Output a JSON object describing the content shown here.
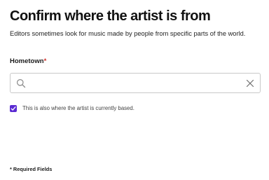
{
  "title": "Confirm where the artist is from",
  "subtitle": "Editors sometimes look for music made by people from specific parts of the world.",
  "hometown_field": {
    "label": "Hometown",
    "required_marker": "*",
    "value": "",
    "placeholder": "",
    "search_icon": "search-icon",
    "clear_icon": "close-icon"
  },
  "based_checkbox": {
    "checked": true,
    "label": "This is also where the artist is currently based.",
    "accent_color": "#5b2bd2"
  },
  "required_note": "* Required Fields",
  "colors": {
    "required_asterisk": "#d0302a",
    "input_border": "#c9c9c9"
  }
}
